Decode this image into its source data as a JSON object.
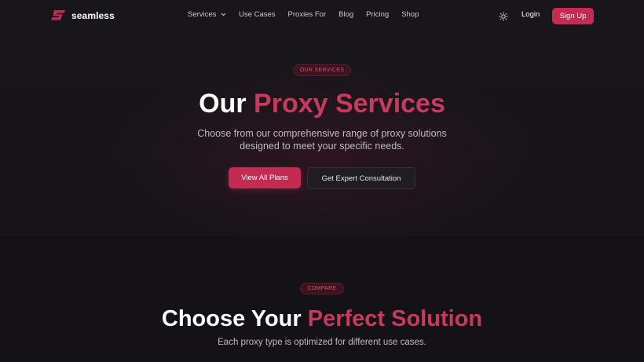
{
  "brand": {
    "name": "seamless",
    "logo_icon": "s-logo-icon",
    "accent_color": "#c42a52"
  },
  "nav": {
    "items": [
      {
        "label": "Services",
        "has_dropdown": true
      },
      {
        "label": "Use Cases"
      },
      {
        "label": "Proxies For"
      },
      {
        "label": "Blog"
      },
      {
        "label": "Pricing"
      },
      {
        "label": "Shop"
      }
    ],
    "theme_icon": "sun-icon",
    "login_label": "Login",
    "signup_label": "Sign Up"
  },
  "hero": {
    "badge": "OUR SERVICES",
    "title_plain": "Our",
    "title_accent": "Proxy Services",
    "subtitle_line1": "Choose from our comprehensive range of proxy solutions",
    "subtitle_line2": "designed to meet your specific needs.",
    "primary_button": "View All Plans",
    "secondary_button": "Get Expert Consultation"
  },
  "compare": {
    "badge": "COMPARE",
    "title_plain": "Choose Your",
    "title_accent": "Perfect Solution",
    "subtitle": "Each proxy type is optimized for different use cases."
  }
}
